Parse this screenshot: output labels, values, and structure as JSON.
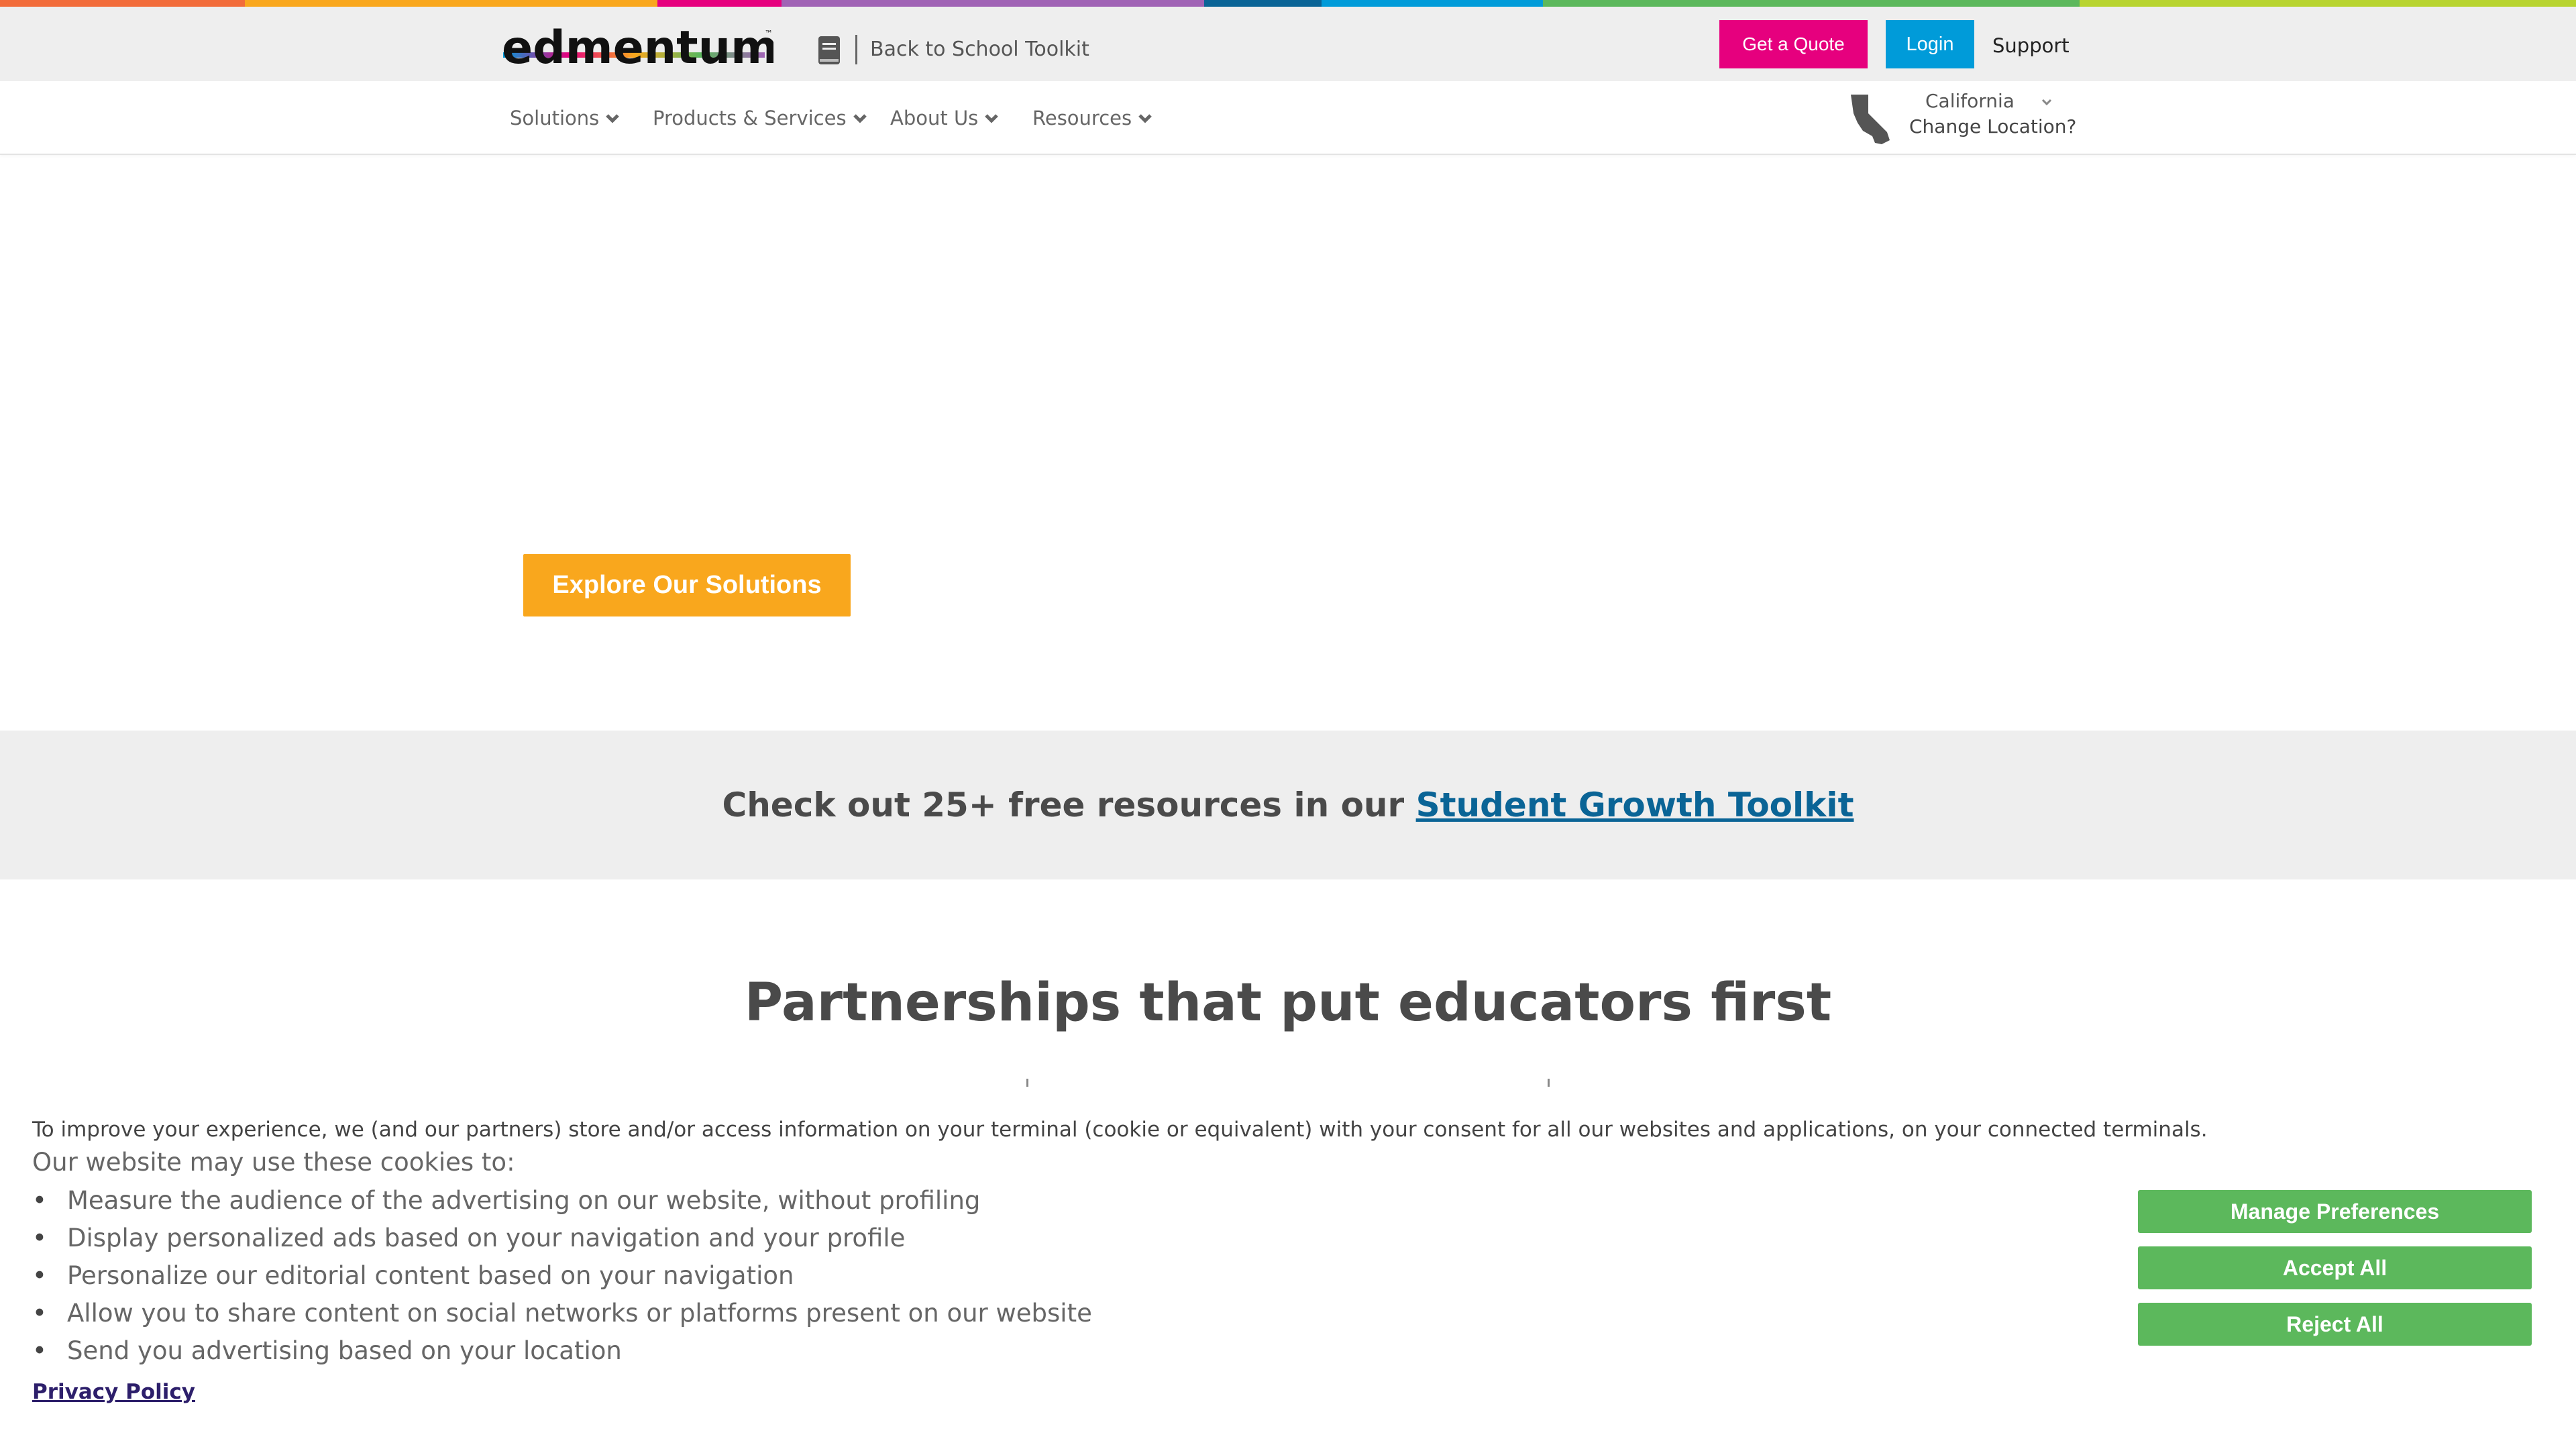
{
  "brand": {
    "name": "edmentum",
    "rainbow_colors": [
      "#f26c3a",
      "#f9a71d",
      "#e6007e",
      "#a063b5",
      "#0a6496",
      "#009bd9",
      "#5cb85c",
      "#b8d430"
    ]
  },
  "header": {
    "back_link": "Back to School Toolkit",
    "get_quote": "Get a Quote",
    "login": "Login",
    "support": "Support"
  },
  "nav": {
    "items": [
      {
        "label": "Solutions"
      },
      {
        "label": "Products & Services"
      },
      {
        "label": "About Us"
      },
      {
        "label": "Resources"
      }
    ],
    "location": {
      "state": "California",
      "change": "Change Location?"
    }
  },
  "hero": {
    "cta": "Explore Our Solutions"
  },
  "promo": {
    "prefix": "Check out 25+ free resources in our ",
    "link": "Student Growth Toolkit"
  },
  "section": {
    "title": "Partnerships that put educators first"
  },
  "cookie": {
    "text": "To improve your experience, we (and our partners) store and/or access information on your terminal (cookie or equivalent) with your consent for all our websites and applications, on your connected terminals.",
    "sub": "Our website may use these cookies to:",
    "items": [
      "Measure the audience of the advertising on our website, without profiling",
      "Display personalized ads based on your navigation and your profile",
      "Personalize our editorial content based on your navigation",
      "Allow you to share content on social networks or platforms present on our website",
      "Send you advertising based on your location"
    ],
    "privacy": "Privacy Policy",
    "buttons": {
      "manage": "Manage Preferences",
      "accept": "Accept All",
      "reject": "Reject All"
    }
  },
  "colors": {
    "quote": "#e6007e",
    "login": "#009bd9",
    "cta": "#f9a71d",
    "cookie_buttons": "#5cb85c",
    "link": "#0a6496"
  }
}
